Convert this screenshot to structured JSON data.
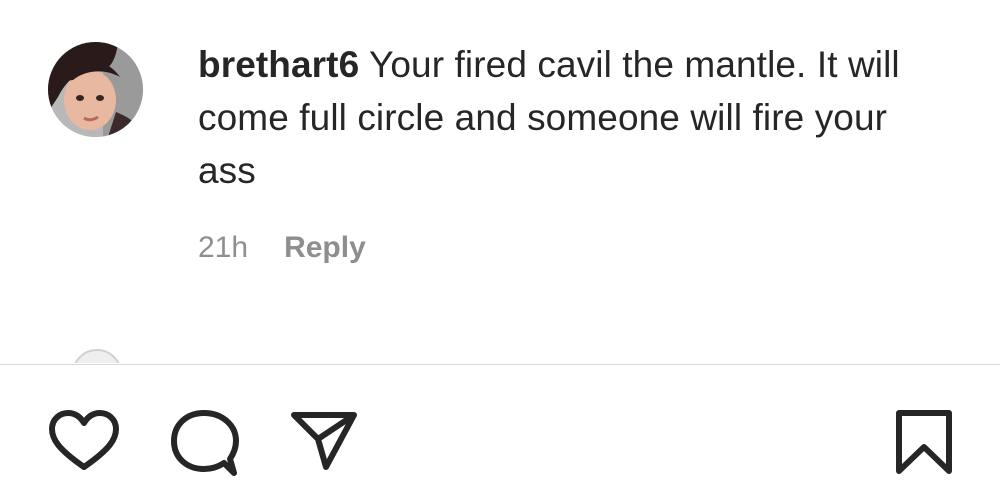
{
  "comment": {
    "username": "brethart6",
    "text": "Your fired cavil the mantle. It will come full circle and someone will fire your ass",
    "time": "21h",
    "reply_label": "Reply"
  },
  "action_bar": {
    "icons": [
      "heart-icon",
      "comment-bubble-icon",
      "paper-plane-icon",
      "bookmark-icon"
    ]
  },
  "colors": {
    "text_primary": "#262626",
    "text_secondary": "#8e8e8e",
    "divider": "#dbdbdb",
    "background": "#ffffff"
  }
}
